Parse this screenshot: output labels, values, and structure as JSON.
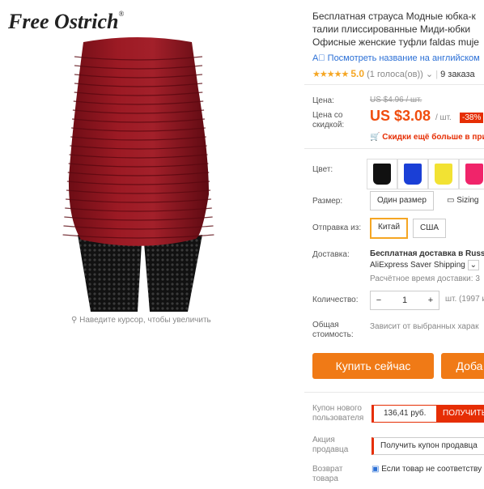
{
  "brand": {
    "logo_text": "Free Ostrich",
    "reg_mark": "®"
  },
  "image": {
    "zoom_hint": "Наведите курсор, чтобы увеличить"
  },
  "product": {
    "title_lines": [
      "Бесплатная страуса Модные юбка-к",
      "талии плиссированные Миди-юбки",
      "Офисные женские туфли faldas muje"
    ],
    "translate_link": "Посмотреть название на английском",
    "rating": {
      "stars": "★★★★★",
      "value": "5.0",
      "votes": "(1 голоса(ов))",
      "orders": "9 заказа"
    }
  },
  "price": {
    "label": "Цена:",
    "old": "US $4.96 / шт.",
    "discount_label": "Цена со скидкой:",
    "new": "US $3.08",
    "per_unit": "/ шт.",
    "badge": "-38%",
    "note": "Скидки ещё больше в при"
  },
  "color": {
    "label": "Цвет:",
    "swatches": [
      "#111111",
      "#1a3fd6",
      "#f2e233",
      "#f0246a"
    ]
  },
  "size": {
    "label": "Размер:",
    "option": "Один размер",
    "sizing_link": "Sizing"
  },
  "ship_from": {
    "label": "Отправка из:",
    "options": [
      "Китай",
      "США"
    ]
  },
  "delivery": {
    "label": "Доставка:",
    "title": "Бесплатная доставка в Russ",
    "method": "AliExpress Saver Shipping",
    "time": "Расчётное время доставки: 3"
  },
  "quantity": {
    "label": "Количество:",
    "minus": "−",
    "value": "1",
    "plus": "+",
    "note": "шт. (1997 и"
  },
  "total": {
    "label_1": "Общая",
    "label_2": "стоимость:",
    "note": "Зависит от выбранных харак"
  },
  "buttons": {
    "buy": "Купить сейчас",
    "cart": "Доба"
  },
  "coupon": {
    "label_1": "Купон нового",
    "label_2": "пользователя",
    "amount": "136,41 руб.",
    "get": "ПОЛУЧИТЬ"
  },
  "promo": {
    "label_1": "Акция",
    "label_2": "продавца",
    "button": "Получить купон продавца"
  },
  "returns": {
    "label_1": "Возврат",
    "label_2": "товара",
    "note": "Если товар не соответству"
  },
  "colors": {
    "accent": "#f07a16",
    "price": "#f04d0e",
    "sale": "#e62e04",
    "link": "#2a6fd6"
  }
}
